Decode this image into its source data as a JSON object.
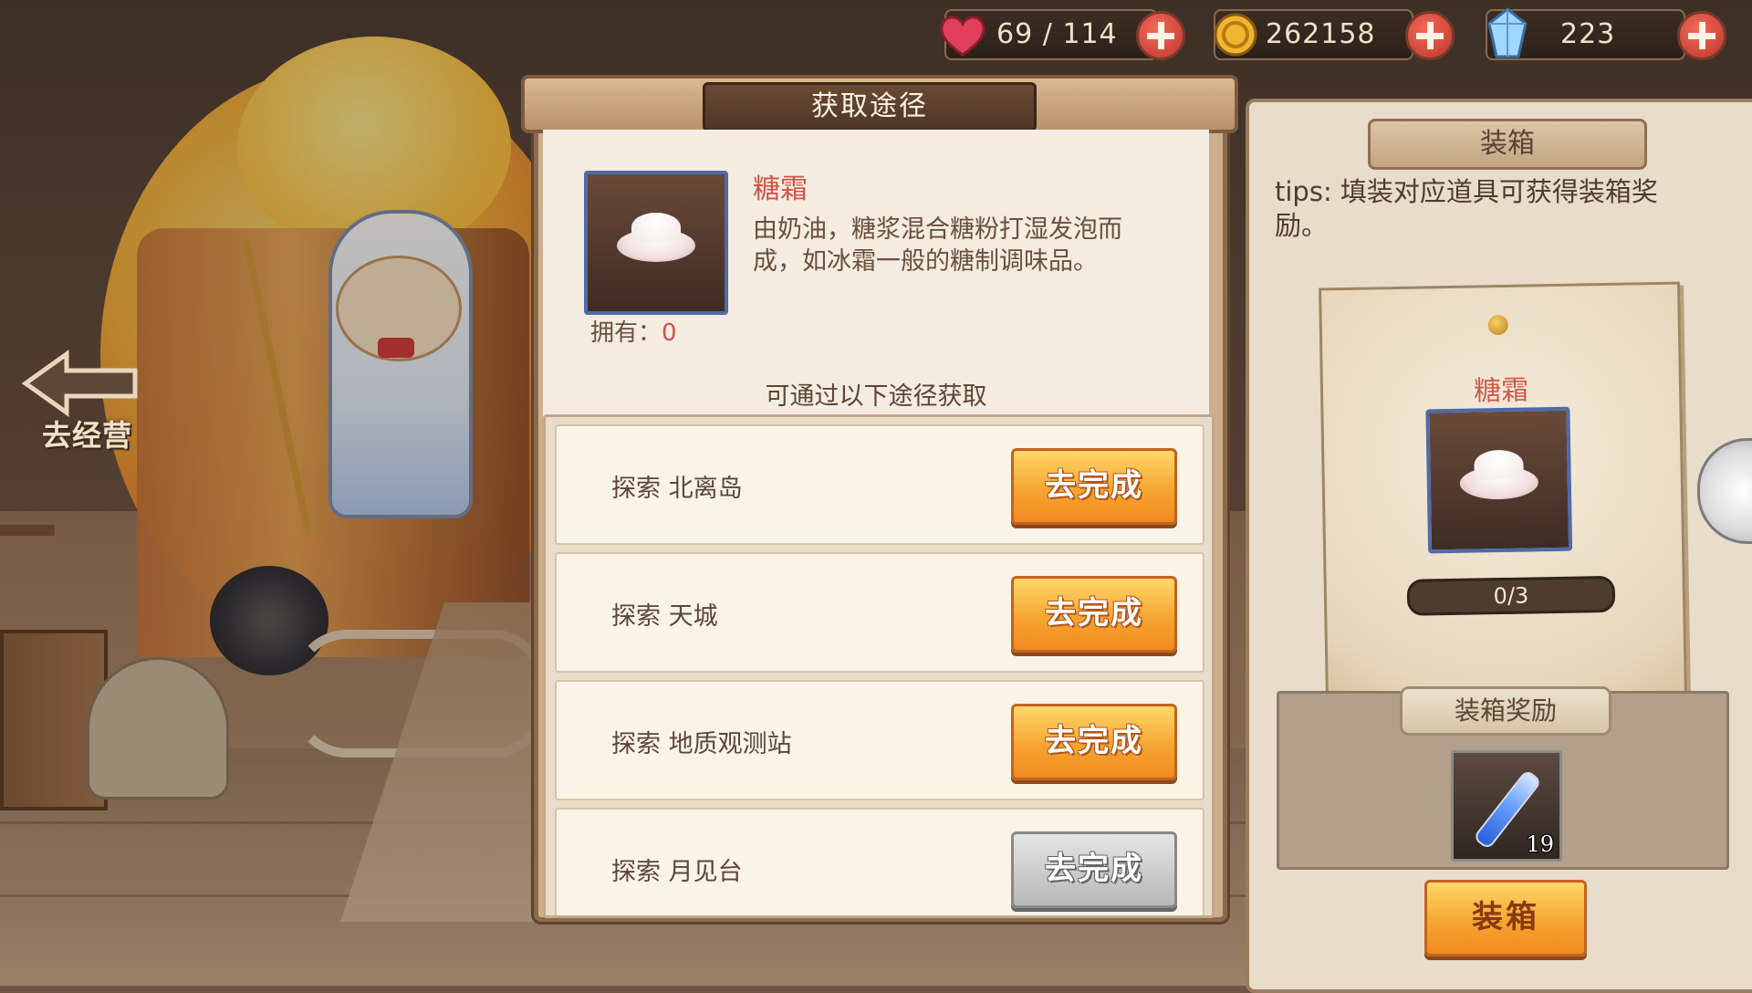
{
  "top_bar": {
    "stamina": {
      "value": "69 / 114",
      "icon": "heart-icon"
    },
    "gold": {
      "value": "262158",
      "icon": "coin-icon"
    },
    "gems": {
      "value": "223",
      "icon": "crystal-icon"
    }
  },
  "nav": {
    "back_label": "去经营"
  },
  "dialog": {
    "title": "获取途径",
    "item": {
      "name": "糖霜",
      "description": "由奶油，糖浆混合糖粉打湿发泡而成，如冰霜一般的糖制调味品。",
      "owned_label": "拥有：",
      "owned_value": "0"
    },
    "routes_heading": "可通过以下途径获取",
    "routes": [
      {
        "label": "探索 北离岛",
        "button": "去完成",
        "enabled": true
      },
      {
        "label": "探索 天城",
        "button": "去完成",
        "enabled": true
      },
      {
        "label": "探索 地质观测站",
        "button": "去完成",
        "enabled": true
      },
      {
        "label": "探索 月见台",
        "button": "去完成",
        "enabled": false
      }
    ]
  },
  "pack_panel": {
    "title": "装箱",
    "tips": "tips: 填装对应道具可获得装箱奖励。",
    "card": {
      "item_name": "糖霜",
      "progress": "0/3",
      "progress_fraction": 0.0
    },
    "reward_title": "装箱奖励",
    "reward": {
      "icon": "potion-vial-icon",
      "count": "19"
    },
    "pack_button": "装箱"
  },
  "colors": {
    "accent_orange": "#f6a531",
    "item_name_red": "#d0524a",
    "frame_brown": "#8b6a4c"
  }
}
